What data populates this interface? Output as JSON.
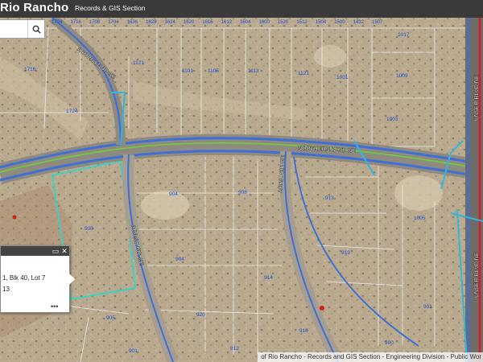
{
  "header": {
    "title": "Rio Rancho",
    "section": "Records & GIS Section"
  },
  "search": {
    "icon": "search-icon"
  },
  "popup": {
    "line1": "1, Blk 40, Lot 7",
    "line2": "13",
    "more": "•••",
    "icons": [
      "maximize-icon",
      "close-icon"
    ]
  },
  "credits": "of Rio Rancho - Records and GIS Section - Engineering Division - Public Wor",
  "streets": {
    "acorn_loop": "ACORN LOOP NE",
    "northern_blvd": "NORTHERN BLVD NE",
    "acano_cir": "ACANO CIR NE",
    "abril_cir": "ABRIL CIR NE",
    "unser_north": "UNSER BLVD NE",
    "unser_south": "UNSER BLVD NE"
  },
  "parcel_numbers": {
    "top_row": [
      "1724",
      "1716",
      "1708",
      "1704",
      "1636",
      "1628",
      "1624",
      "1620",
      "1616",
      "1612",
      "1604",
      "1600",
      "1520",
      "1512",
      "1504",
      "1500",
      "1432",
      "1507"
    ],
    "n1716": "1716",
    "n1724": "1724",
    "n1121": "1121",
    "n1101": "1101",
    "n1105": "1105",
    "n1113": "1113",
    "n1121b": "1121",
    "n1001": "1001",
    "n1009": "1009",
    "n1003": "1003",
    "n1017": "1017",
    "n904": "904",
    "n908": "908",
    "n913": "913",
    "n919": "919",
    "n1005": "1005",
    "n900": "900",
    "n904b": "904",
    "n914": "914",
    "n920": "920",
    "n901": "901",
    "n905": "905",
    "n901b": "901",
    "n912": "912",
    "n910": "910",
    "n900b": "900"
  },
  "colors": {
    "road_blue": "#3f6fd6",
    "road_green": "#6fcf3a",
    "selected_parcel": "#2fd6c8",
    "parcel_line": "#e8e8e8",
    "header_bg": "#3a3a3a",
    "hydrant_red": "#d81c1c"
  }
}
